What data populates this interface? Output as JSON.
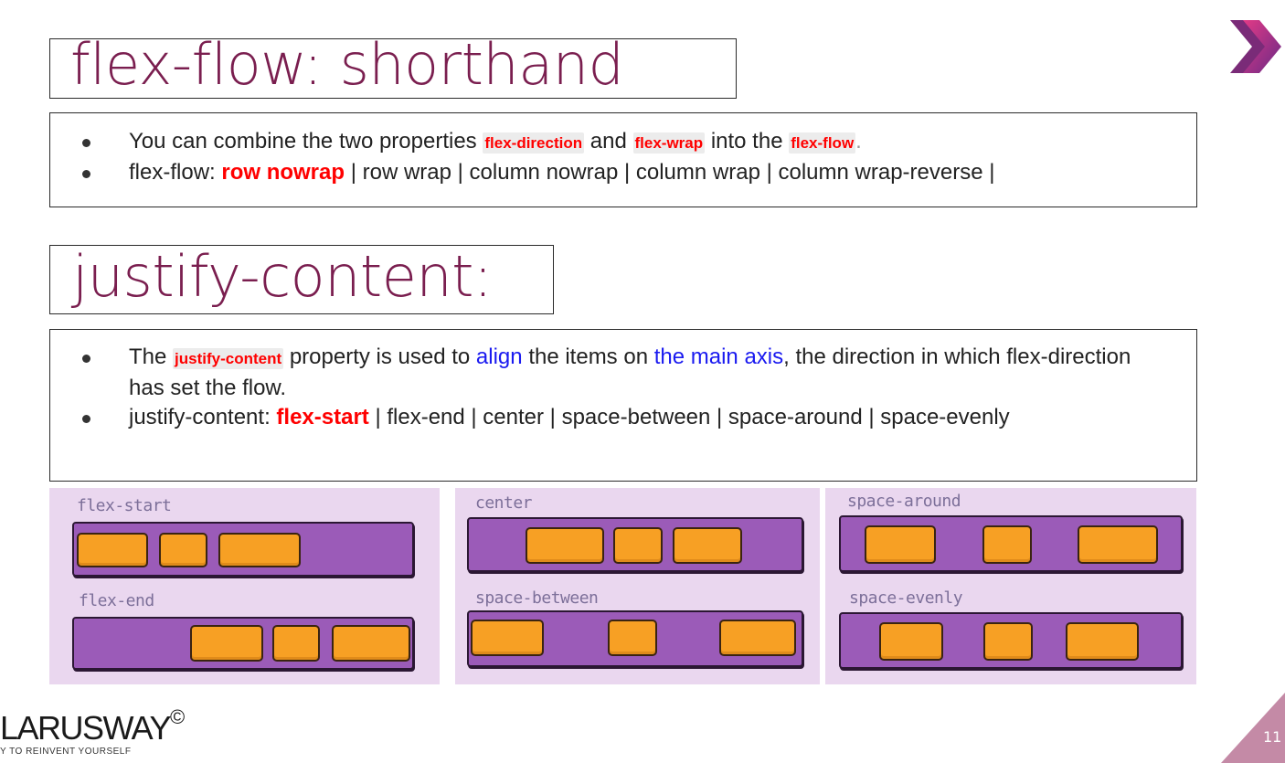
{
  "section1": {
    "title": "flex-flow: shorthand",
    "bullet1": {
      "pre": "You can combine the two properties",
      "code1": "flex-direction",
      "mid": "and",
      "code2": "flex-wrap",
      "mid2": "into the",
      "code3": "flex-flow",
      "end": "."
    },
    "bullet2": {
      "pre": "flex-flow:",
      "highlight": "row nowrap",
      "rest": "| row wrap | column nowrap | column wrap | column wrap-reverse |"
    }
  },
  "section2": {
    "title": "justify-content:",
    "bullet1": {
      "pre": "The",
      "code": "justify-content",
      "mid": "property is used to",
      "blue1": "align",
      "mid2": "the items on",
      "blue2": "the main axis",
      "end": ", the direction in which flex-direction has set the flow."
    },
    "bullet2": {
      "pre": "justify-content:",
      "highlight": "flex-start",
      "rest": "| flex-end | center | space-between | space-around | space-evenly"
    }
  },
  "illustrations": {
    "flex_start": "flex-start",
    "flex_end": "flex-end",
    "center": "center",
    "space_between": "space-between",
    "space_around": "space-around",
    "space_evenly": "space-evenly"
  },
  "footer": {
    "brand": "LARUSWAY",
    "copyright": "©",
    "tagline": "Y TO REINVENT YOURSELF",
    "page_number": "11"
  },
  "colors": {
    "title": "#7a1e4f",
    "code_red": "#ff0000",
    "blue_text": "#1a1af0",
    "panel_bg": "#ead7ef",
    "bar_purple": "#9b5bb8",
    "item_orange": "#f7a024",
    "corner_mauve": "#c48aa6"
  },
  "icons": {
    "top_right": "double-chevron-logo-icon"
  }
}
